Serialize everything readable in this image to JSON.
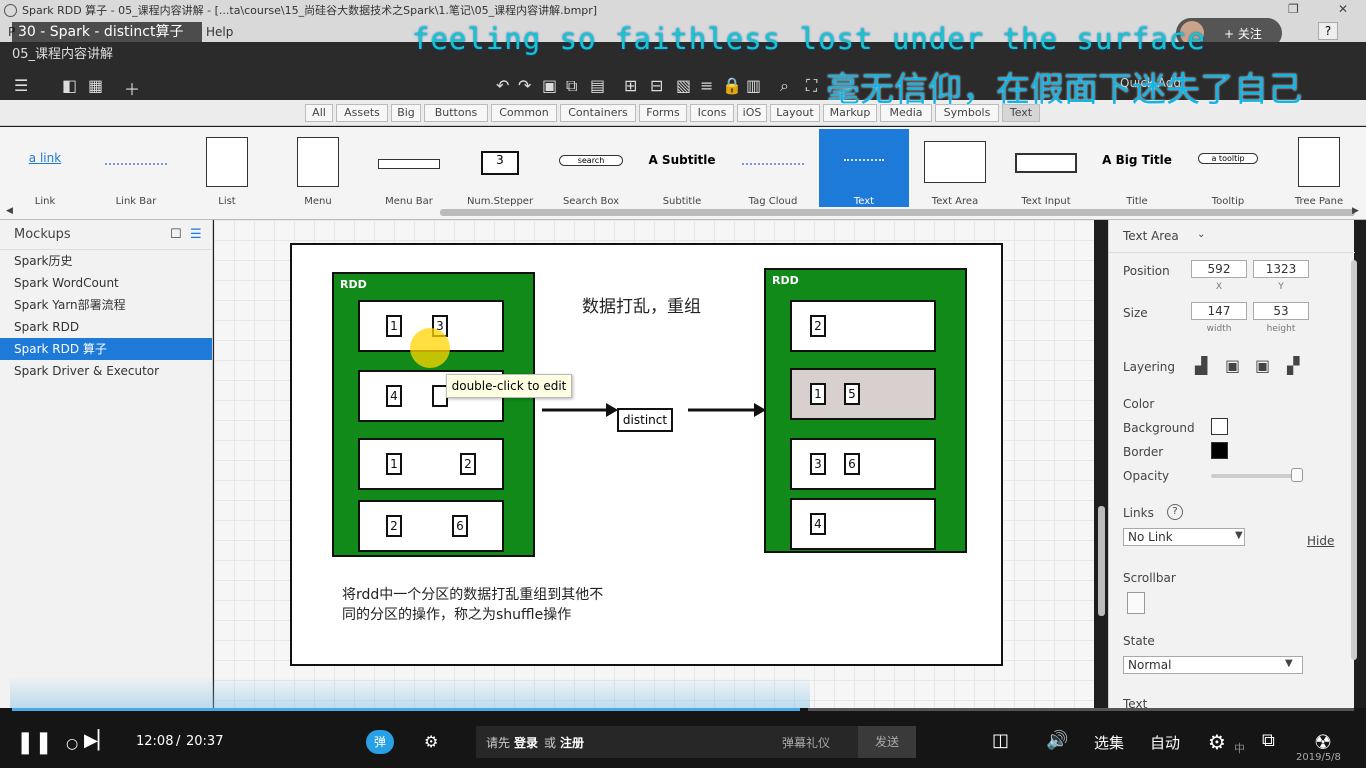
{
  "window": {
    "title": "Spark RDD 算子 - 05_课程内容讲解 - [...ta\\course\\15_尚硅谷大数据技术之Spark\\1.笔记\\05_课程内容讲解.bmpr]",
    "video_title": "30 - Spark - distinct算子",
    "follow_label": "+ 关注",
    "help_menu": "Help",
    "menu_hidden_label": "P"
  },
  "overlay": {
    "lyric_en": "feeling so faithless lost under the surface",
    "lyric_zh": "毫无信仰，在假面下迷失了自己",
    "quick_add": "Quick Add"
  },
  "mockup_title": "05_课程内容讲解",
  "filter_tabs": [
    "All",
    "Assets",
    "Big",
    "Buttons",
    "Common",
    "Containers",
    "Forms",
    "Icons",
    "iOS",
    "Layout",
    "Markup",
    "Media",
    "Symbols",
    "Text"
  ],
  "palette": {
    "items": [
      {
        "label": "Link",
        "thumb": "a link"
      },
      {
        "label": "Link Bar",
        "thumb": ""
      },
      {
        "label": "List",
        "thumb": ""
      },
      {
        "label": "Menu",
        "thumb": ""
      },
      {
        "label": "Menu Bar",
        "thumb": ""
      },
      {
        "label": "Num.Stepper",
        "thumb": "3"
      },
      {
        "label": "Search Box",
        "thumb": "search"
      },
      {
        "label": "Subtitle",
        "thumb": "A Subtitle"
      },
      {
        "label": "Tag Cloud",
        "thumb": ""
      },
      {
        "label": "Text",
        "thumb": ""
      },
      {
        "label": "Text Area",
        "thumb": ""
      },
      {
        "label": "Text Input",
        "thumb": ""
      },
      {
        "label": "Title",
        "thumb": "A Big Title"
      },
      {
        "label": "Tooltip",
        "thumb": "a tooltip"
      },
      {
        "label": "Tree Pane",
        "thumb": ""
      }
    ]
  },
  "sidebar": {
    "title": "Mockups",
    "items": [
      "Spark历史",
      "Spark WordCount",
      "Spark Yarn部署流程",
      "Spark RDD",
      "Spark RDD 算子",
      "Spark Driver & Executor"
    ]
  },
  "canvas": {
    "rdd_left_label": "RDD",
    "rdd_right_label": "RDD",
    "heading": "数据打乱，重组",
    "distinct_label": "distinct",
    "tooltip": "double-click to edit",
    "note_line1": "将rdd中一个分区的数据打乱重组到其他不",
    "note_line2": "同的分区的操作，称之为shuffle操作",
    "left_partitions": [
      [
        "1",
        "3"
      ],
      [
        "4",
        ""
      ],
      [
        "1",
        "2"
      ],
      [
        "2",
        "6"
      ]
    ],
    "right_partitions": [
      [
        "2"
      ],
      [
        "1",
        "5"
      ],
      [
        "3",
        "6"
      ],
      [
        "4"
      ]
    ]
  },
  "properties": {
    "header": "Text Area",
    "position_label": "Position",
    "x_value": "592",
    "y_value": "1323",
    "x_sub": "X",
    "y_sub": "Y",
    "size_label": "Size",
    "width_value": "147",
    "height_value": "53",
    "width_sub": "width",
    "height_sub": "height",
    "layering_label": "Layering",
    "color_label": "Color",
    "background_label": "Background",
    "border_label": "Border",
    "opacity_label": "Opacity",
    "links_label": "Links",
    "link_value": "No Link",
    "hide_label": "Hide",
    "scrollbar_label": "Scrollbar",
    "state_label": "State",
    "state_value": "Normal",
    "text_label": "Text"
  },
  "player": {
    "time_current": "12:08",
    "time_sep": "/",
    "time_total": "20:37",
    "danmaku_button": "弹",
    "login_prompt": "请先",
    "login": "登录",
    "or": "或",
    "register": "注册",
    "danmaku_etiquette": "弹幕礼仪",
    "send": "发送",
    "episodes": "选集",
    "auto": "自动",
    "date": "2019/5/8",
    "ime_label": "中",
    "progress": 0.587
  },
  "colors": {
    "rdd_green": "#118a1a",
    "selection_blue": "#1e7ad9",
    "lyric": "#14c8c8"
  }
}
